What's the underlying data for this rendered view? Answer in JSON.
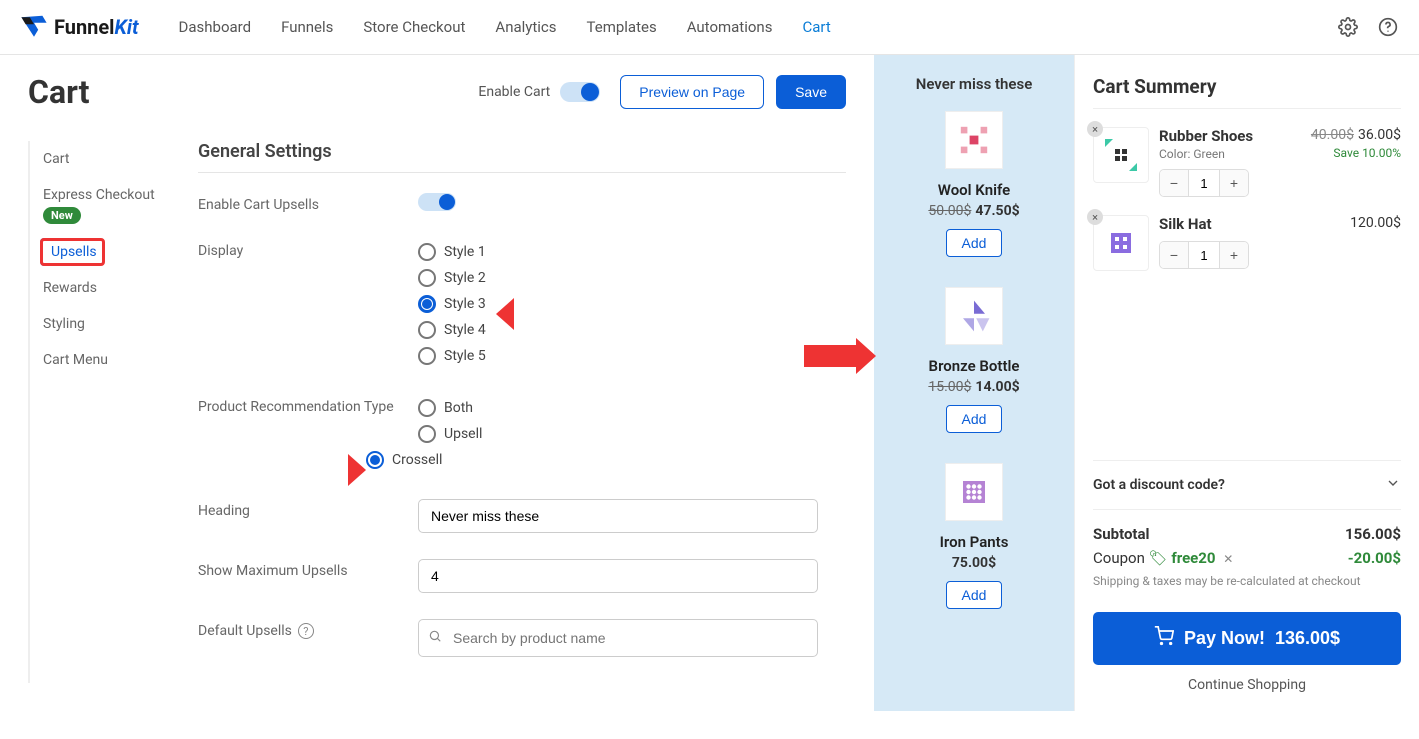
{
  "brand": {
    "name_a": "Funnel",
    "name_b": "Kit"
  },
  "nav": {
    "items": [
      "Dashboard",
      "Funnels",
      "Store Checkout",
      "Analytics",
      "Templates",
      "Automations",
      "Cart"
    ],
    "active": "Cart"
  },
  "header": {
    "title": "Cart",
    "enable_label": "Enable Cart",
    "preview_btn": "Preview on Page",
    "save_btn": "Save"
  },
  "sidenav": {
    "items": [
      {
        "label": "Cart"
      },
      {
        "label": "Express Checkout",
        "badge": "New"
      },
      {
        "label": "Upsells",
        "active": true,
        "highlight": true
      },
      {
        "label": "Rewards"
      },
      {
        "label": "Styling"
      },
      {
        "label": "Cart Menu"
      }
    ]
  },
  "settings": {
    "title": "General Settings",
    "enable_upsells_label": "Enable Cart Upsells",
    "display_label": "Display",
    "display_options": [
      "Style 1",
      "Style 2",
      "Style 3",
      "Style 4",
      "Style 5"
    ],
    "display_selected": "Style 3",
    "rec_label": "Product Recommendation Type",
    "rec_options": [
      "Both",
      "Upsell",
      "Crossell"
    ],
    "rec_selected": "Crossell",
    "heading_label": "Heading",
    "heading_value": "Never miss these",
    "max_label": "Show Maximum Upsells",
    "max_value": "4",
    "default_label": "Default Upsells",
    "default_placeholder": "Search by product name"
  },
  "preview": {
    "heading": "Never miss these",
    "add_label": "Add",
    "products": [
      {
        "name": "Wool Knife",
        "old": "50.00$",
        "new": "47.50$",
        "thumb": "pink"
      },
      {
        "name": "Bronze Bottle",
        "old": "15.00$",
        "new": "14.00$",
        "thumb": "purple-tri"
      },
      {
        "name": "Iron Pants",
        "old": "",
        "new": "75.00$",
        "thumb": "purple-dots"
      }
    ]
  },
  "summary": {
    "title": "Cart Summery",
    "items": [
      {
        "name": "Rubber Shoes",
        "sub": "Color: Green",
        "old": "40.00$",
        "new": "36.00$",
        "save": "Save 10.00%",
        "qty": "1",
        "thumb": "teal"
      },
      {
        "name": "Silk Hat",
        "sub": "",
        "old": "",
        "new": "120.00$",
        "save": "",
        "qty": "1",
        "thumb": "violet"
      }
    ],
    "discount_label": "Got a discount code?",
    "subtotal_label": "Subtotal",
    "subtotal_value": "156.00$",
    "coupon_label": "Coupon",
    "coupon_code": "free20",
    "coupon_value": "-20.00$",
    "note": "Shipping & taxes may be re-calculated at checkout",
    "pay_label": "Pay Now!",
    "pay_amount": "136.00$",
    "continue_label": "Continue Shopping"
  }
}
